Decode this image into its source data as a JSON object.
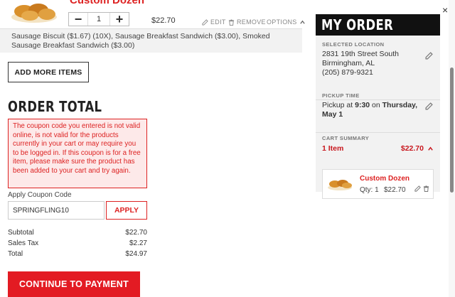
{
  "item": {
    "name": "Custom Dozen",
    "quantity": "1",
    "minus": "−",
    "plus": "+",
    "price": "$22.70",
    "edit_label": "EDIT",
    "remove_label": "REMOVE",
    "options_label": "OPTIONS",
    "details": "Sausage Biscuit ($1.67) (10X), Sausage Breakfast Sandwich ($3.00), Smoked Sausage Breakfast Sandwich ($3.00)"
  },
  "add_more_label": "ADD MORE ITEMS",
  "order_total": {
    "title": "ORDER TOTAL",
    "error": "The coupon code you entered is not valid online, is not valid for the products currently in your cart or may require you to be logged in. If this coupon is for a free item, please make sure the product has been added to your cart and try again.",
    "coupon_label": "Apply Coupon Code",
    "coupon_value": "SPRINGFLING10",
    "apply_label": "APPLY",
    "rows": [
      {
        "label": "Subtotal",
        "value": "$22.70"
      },
      {
        "label": "Sales Tax",
        "value": "$2.27"
      },
      {
        "label": "Total",
        "value": "$24.97"
      }
    ],
    "continue_label": "CONTINUE TO PAYMENT"
  },
  "my_order": {
    "title": "MY ORDER",
    "location_title": "SELECTED LOCATION",
    "address1": "2831 19th Street South",
    "address2": "Birmingham, AL",
    "phone": "(205) 879-9321",
    "pickup_title": "PICKUP TIME",
    "pickup_prefix": "Pickup at ",
    "pickup_time": "9:30",
    "pickup_mid": " on ",
    "pickup_day": "Thursday, May 1",
    "cart_title": "CART SUMMARY",
    "cart_count": "1 Item",
    "cart_total": "$22.70",
    "cart_item_name": "Custom Dozen",
    "cart_item_qty": "Qty: 1",
    "cart_item_price": "$22.70"
  },
  "colors": {
    "accent": "#e31b23",
    "error_bg": "#fde9e9",
    "panel_bg": "#f2f2f2",
    "header_bg": "#111111"
  }
}
